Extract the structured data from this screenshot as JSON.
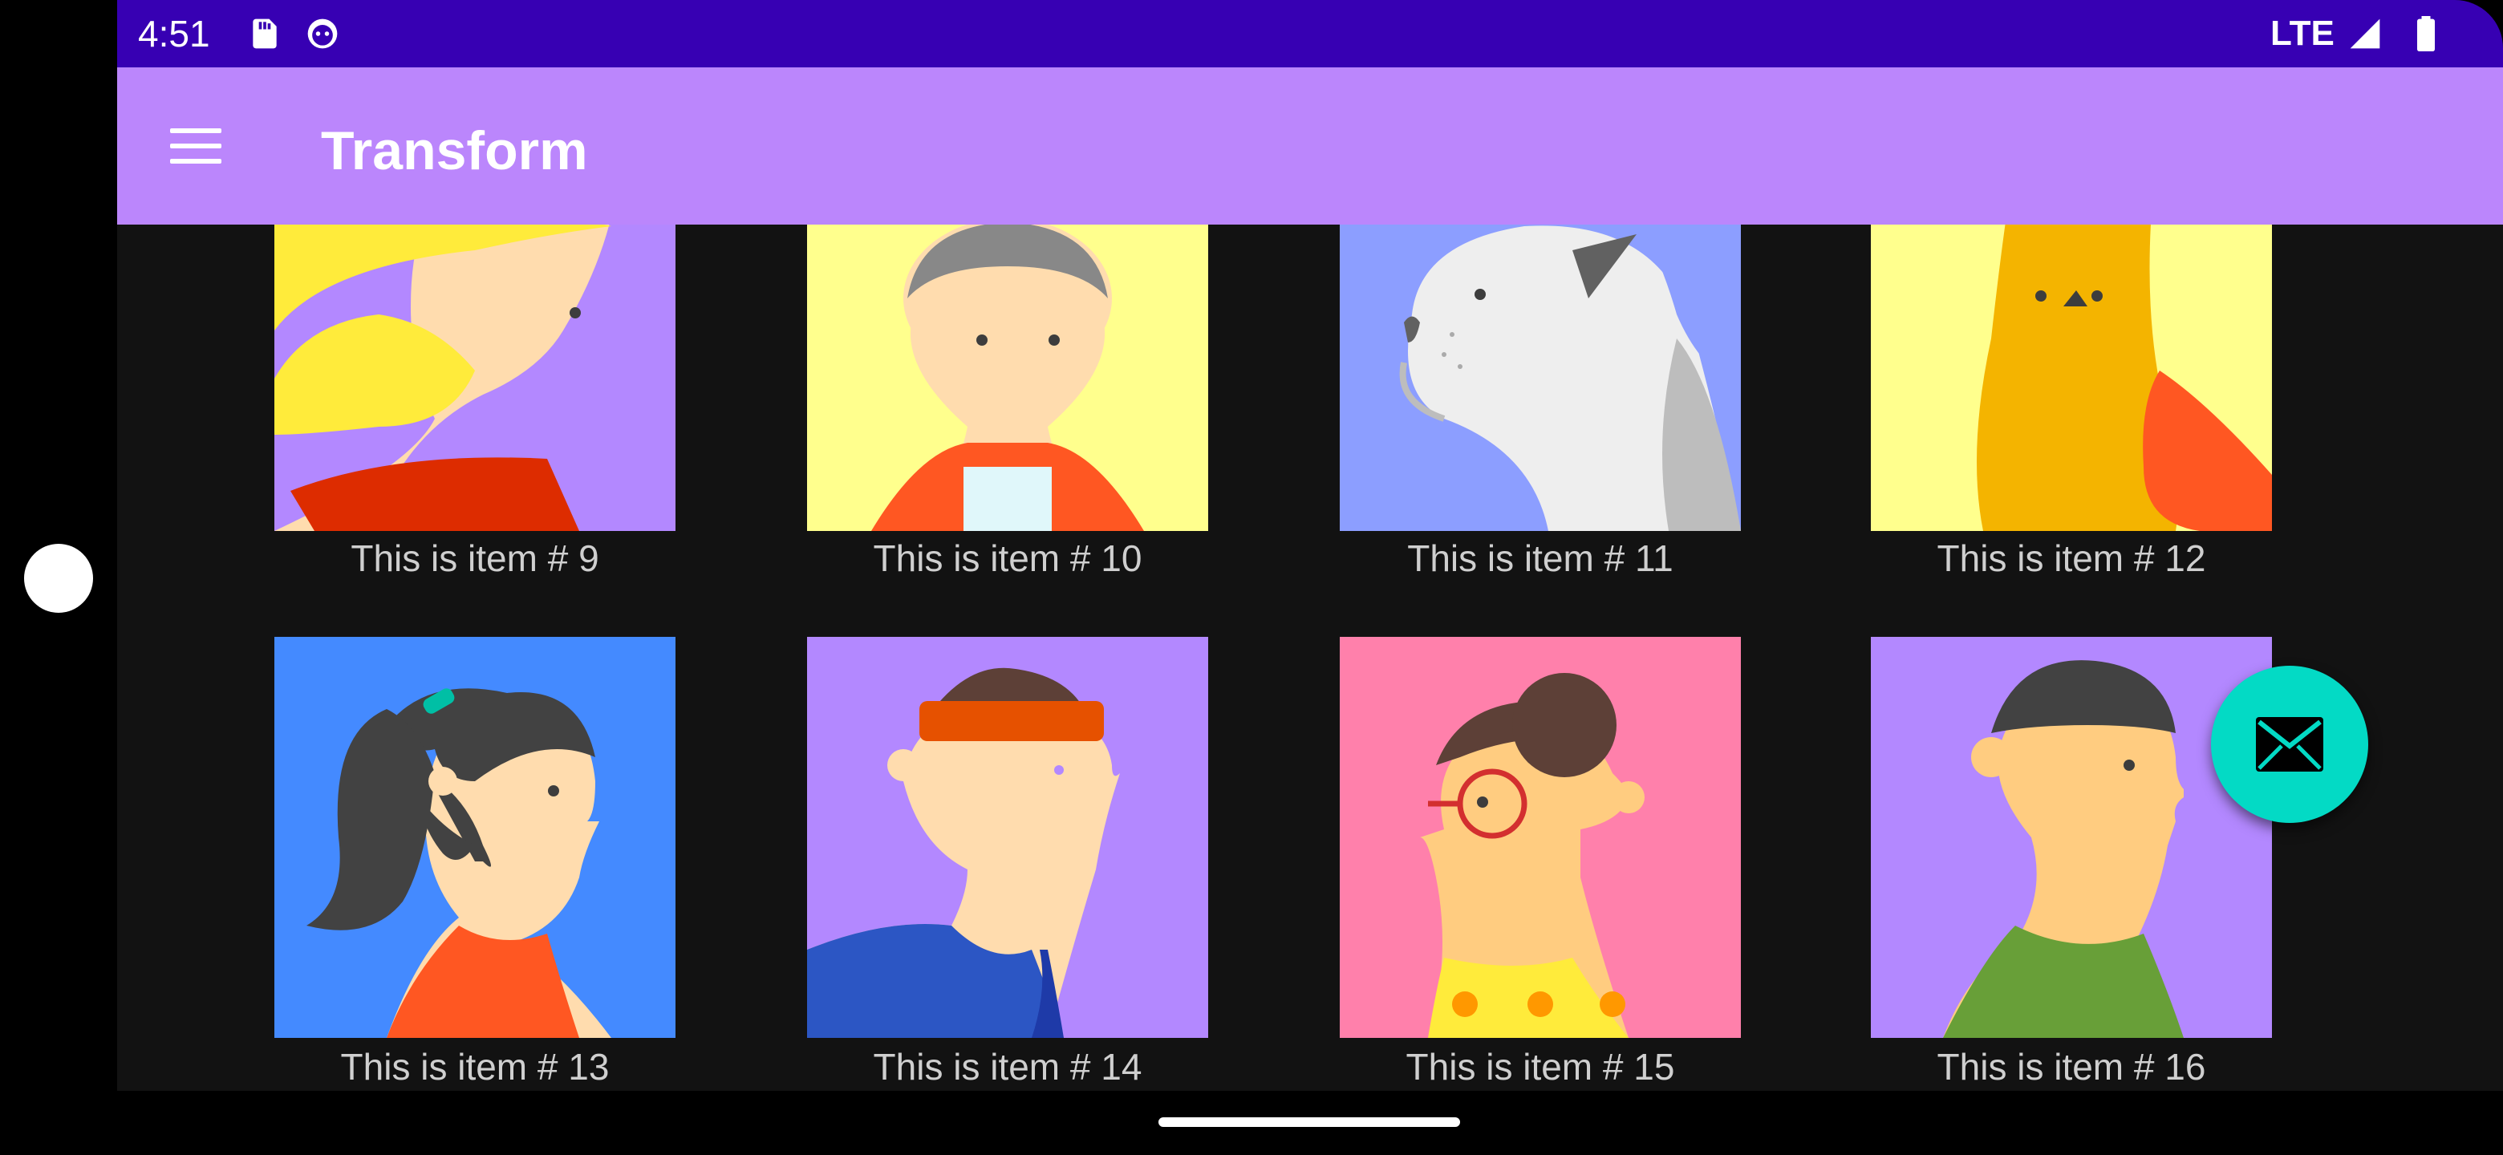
{
  "status_bar": {
    "time": "4:51",
    "network": "LTE",
    "icons": [
      "sd-card-icon",
      "android-debug-icon",
      "signal-icon",
      "battery-icon"
    ]
  },
  "app_bar": {
    "title": "Transform",
    "menu_icon": "hamburger-menu-icon"
  },
  "items": [
    {
      "caption": "This is item # 9",
      "bg": "#b388ff",
      "avatar": "woman-blonde-hair"
    },
    {
      "caption": "This is item # 10",
      "bg": "#ffff8d",
      "avatar": "man-gray-hair"
    },
    {
      "caption": "This is item # 11",
      "bg": "#8c9eff",
      "avatar": "white-dog"
    },
    {
      "caption": "This is item # 12",
      "bg": "#ffff8d",
      "avatar": "orange-cat"
    },
    {
      "caption": "This is item # 13",
      "bg": "#448aff",
      "avatar": "woman-ponytail"
    },
    {
      "caption": "This is item # 14",
      "bg": "#b388ff",
      "avatar": "man-headband"
    },
    {
      "caption": "This is item # 15",
      "bg": "#ff80ab",
      "avatar": "woman-glasses-bun"
    },
    {
      "caption": "This is item # 16",
      "bg": "#b388ff",
      "avatar": "man-green-shirt"
    }
  ],
  "fab": {
    "icon": "email-icon",
    "color": "#03dac5"
  },
  "colors": {
    "status_bar": "#3700b3",
    "app_bar": "#bb86fc",
    "background": "#121212"
  }
}
